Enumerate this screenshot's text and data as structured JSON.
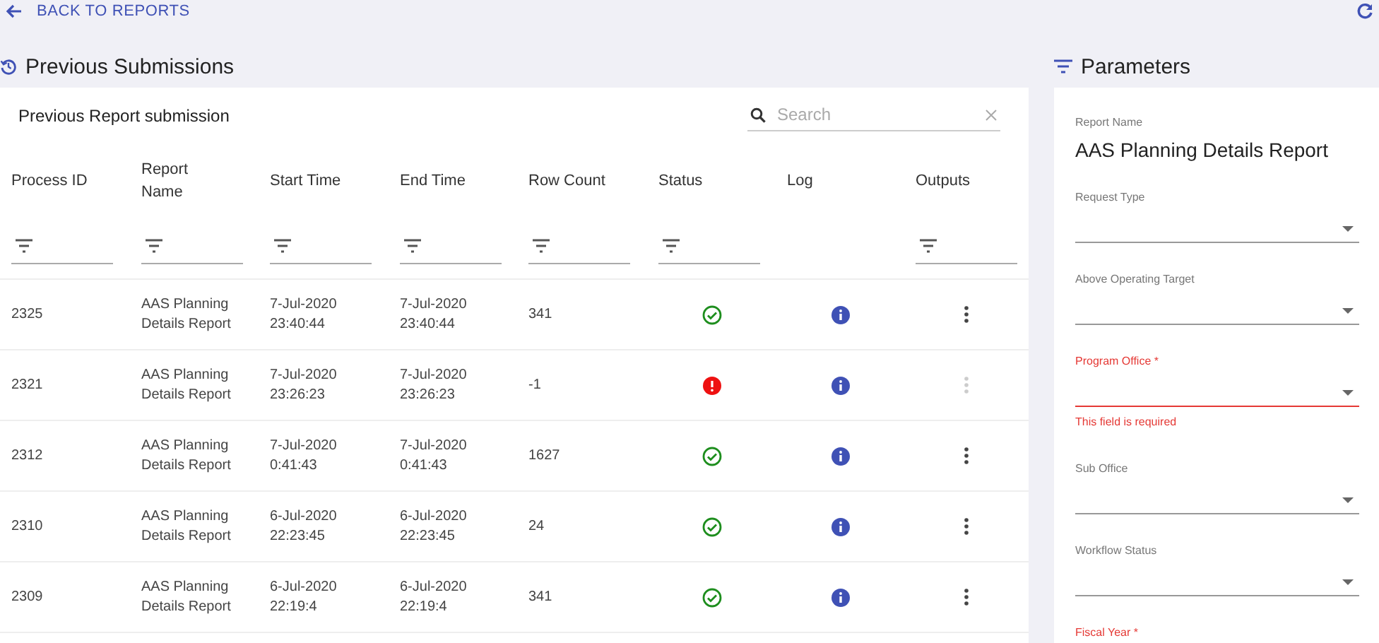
{
  "back_link": "BACK TO REPORTS",
  "submissions": {
    "title": "Previous Submissions",
    "card_title": "Previous Report submission",
    "search": {
      "placeholder": "Search"
    },
    "table": {
      "columns": [
        {
          "label": "Process ID",
          "filterable": true
        },
        {
          "label": "Report Name",
          "filterable": true
        },
        {
          "label": "Start Time",
          "filterable": true
        },
        {
          "label": "End Time",
          "filterable": true
        },
        {
          "label": "Row Count",
          "filterable": true
        },
        {
          "label": "Status",
          "filterable": true
        },
        {
          "label": "Log",
          "filterable": false
        },
        {
          "label": "Outputs",
          "filterable": true
        }
      ],
      "rows": [
        {
          "process_id": "2325",
          "report_name": "AAS Planning Details Report",
          "start_time": "7-Jul-2020 23:40:44",
          "end_time": "7-Jul-2020 23:40:44",
          "row_count": "341",
          "failed": false,
          "outputs_disabled": false
        },
        {
          "process_id": "2321",
          "report_name": "AAS Planning Details Report",
          "start_time": "7-Jul-2020 23:26:23",
          "end_time": "7-Jul-2020 23:26:23",
          "row_count": "-1",
          "failed": true,
          "outputs_disabled": true
        },
        {
          "process_id": "2312",
          "report_name": "AAS Planning Details Report",
          "start_time": "7-Jul-2020 0:41:43",
          "end_time": "7-Jul-2020 0:41:43",
          "row_count": "1627",
          "failed": false,
          "outputs_disabled": false
        },
        {
          "process_id": "2310",
          "report_name": "AAS Planning Details Report",
          "start_time": "6-Jul-2020 22:23:45",
          "end_time": "6-Jul-2020 22:23:45",
          "row_count": "24",
          "failed": false,
          "outputs_disabled": false
        },
        {
          "process_id": "2309",
          "report_name": "AAS Planning Details Report",
          "start_time": "6-Jul-2020 22:19:4",
          "end_time": "6-Jul-2020 22:19:4",
          "row_count": "341",
          "failed": false,
          "outputs_disabled": false
        }
      ]
    }
  },
  "parameters": {
    "title": "Parameters",
    "report_name_label": "Report Name",
    "report_name": "AAS Planning Details Report",
    "fields": [
      {
        "kind": "select",
        "label": "Request Type",
        "invalid": false
      },
      {
        "kind": "select",
        "label": "Above Operating Target",
        "invalid": false
      },
      {
        "kind": "select",
        "label": "Program Office *",
        "invalid": true,
        "error_text": "This field is required"
      },
      {
        "kind": "select",
        "label": "Sub Office",
        "invalid": false
      },
      {
        "kind": "select",
        "label": "Workflow Status",
        "invalid": false
      },
      {
        "kind": "cutoff",
        "label": "Fiscal Year *",
        "invalid": true
      }
    ]
  }
}
